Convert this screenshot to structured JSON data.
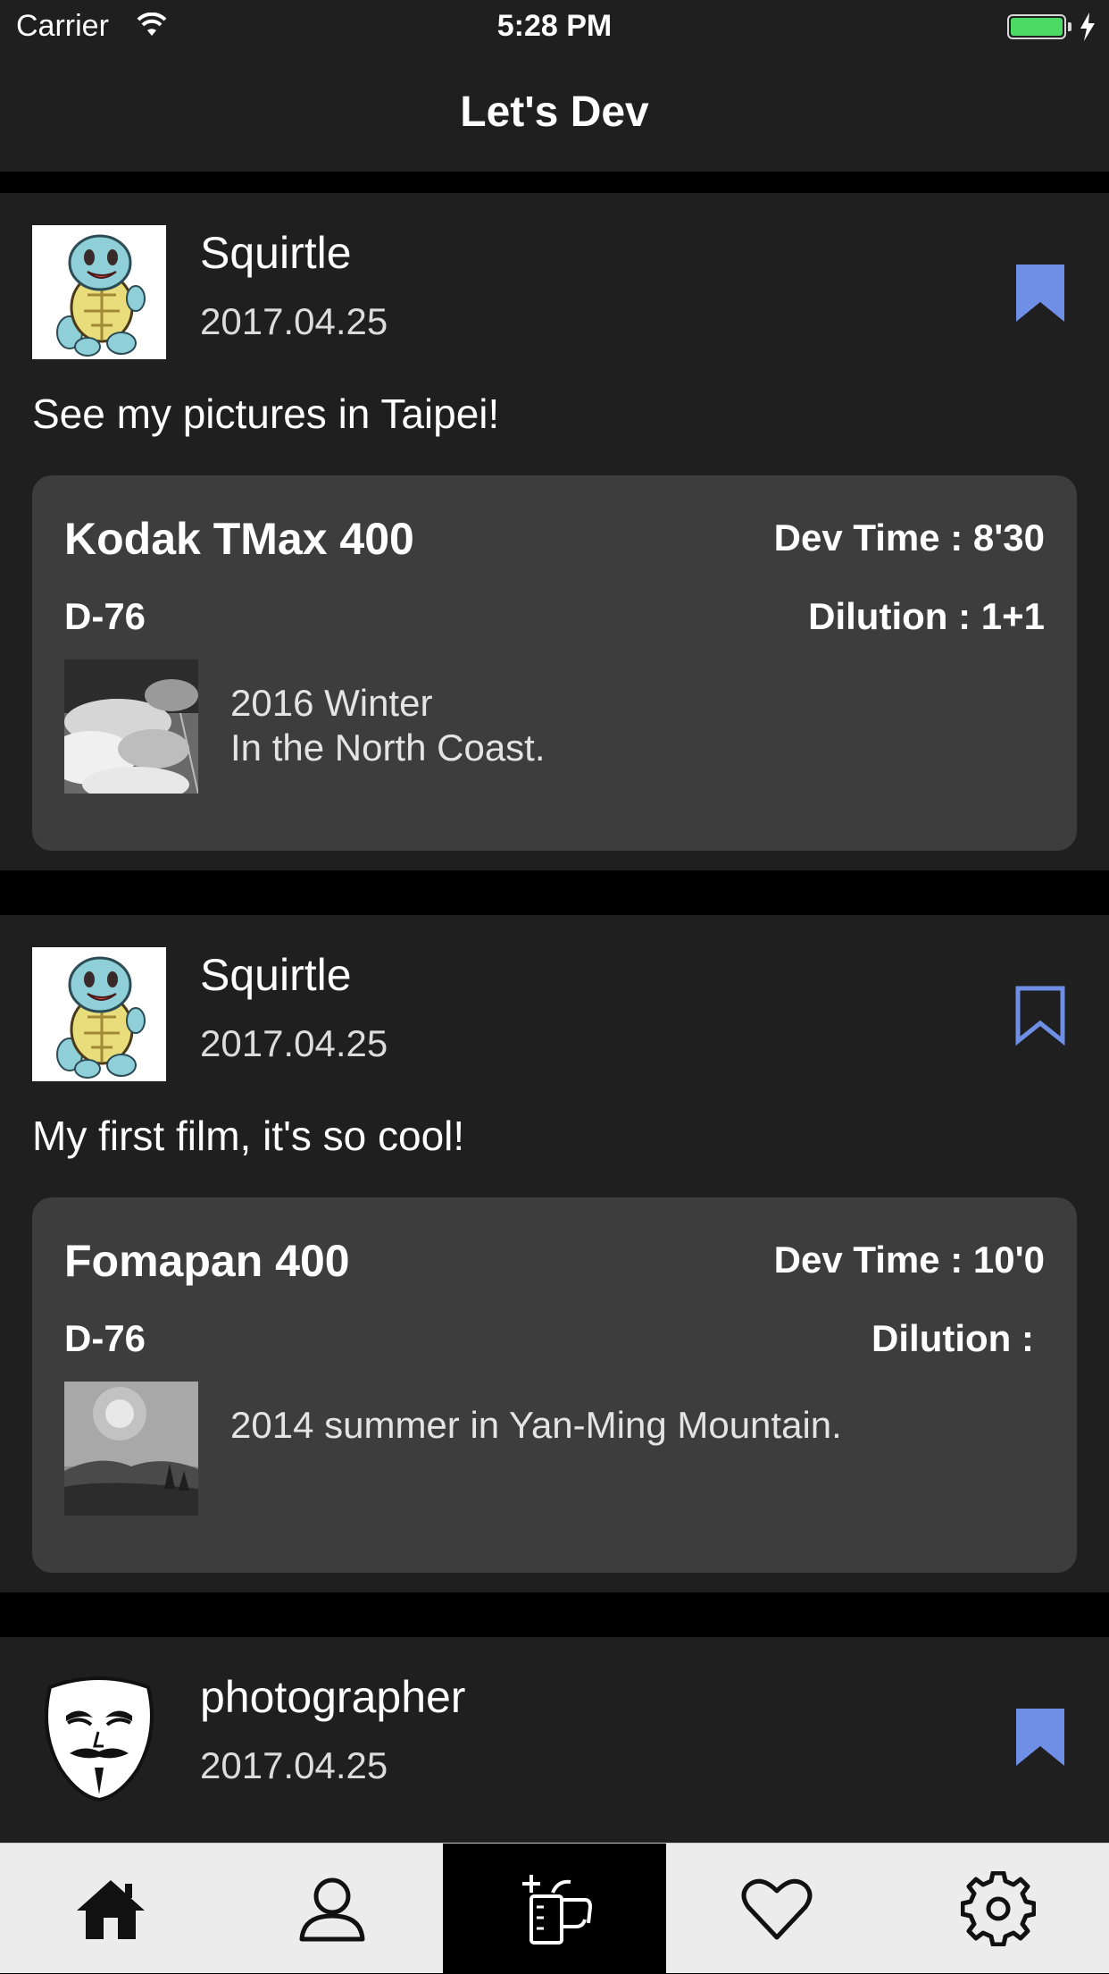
{
  "status_bar": {
    "carrier": "Carrier",
    "time": "5:28 PM",
    "battery_color": "#4cd964"
  },
  "nav": {
    "title": "Let's Dev"
  },
  "colors": {
    "bookmark_accent": "#6f8fe6",
    "card_background": "#3d3d3e",
    "item_background": "#1f1f20"
  },
  "feed": [
    {
      "user": "Squirtle",
      "avatar_icon": "squirtle-avatar",
      "date": "2017.04.25",
      "bookmarked": true,
      "caption": "See my pictures in Taipei!",
      "film": {
        "name": "Kodak TMax 400",
        "dev_time": "Dev Time : 8'30",
        "developer": "D-76",
        "dilution": "Dilution : 1+1",
        "thumbnail": "clouds-photo",
        "note": "2016 Winter\nIn the North Coast."
      }
    },
    {
      "user": "Squirtle",
      "avatar_icon": "squirtle-avatar",
      "date": "2017.04.25",
      "bookmarked": false,
      "caption": "My first film, it's so cool!",
      "film": {
        "name": "Fomapan 400",
        "dev_time": "Dev Time : 10'0",
        "developer": "D-76",
        "dilution": "Dilution :",
        "thumbnail": "mountain-photo",
        "note": "2014 summer in Yan-Ming Mountain."
      }
    },
    {
      "user": "photographer",
      "avatar_icon": "mask-avatar",
      "date": "2017.04.25",
      "bookmarked": true
    }
  ],
  "tabbar": [
    {
      "icon": "home-icon",
      "active": false
    },
    {
      "icon": "profile-icon",
      "active": false
    },
    {
      "icon": "add-film-icon",
      "active": true
    },
    {
      "icon": "heart-icon",
      "active": false
    },
    {
      "icon": "gear-icon",
      "active": false
    }
  ]
}
